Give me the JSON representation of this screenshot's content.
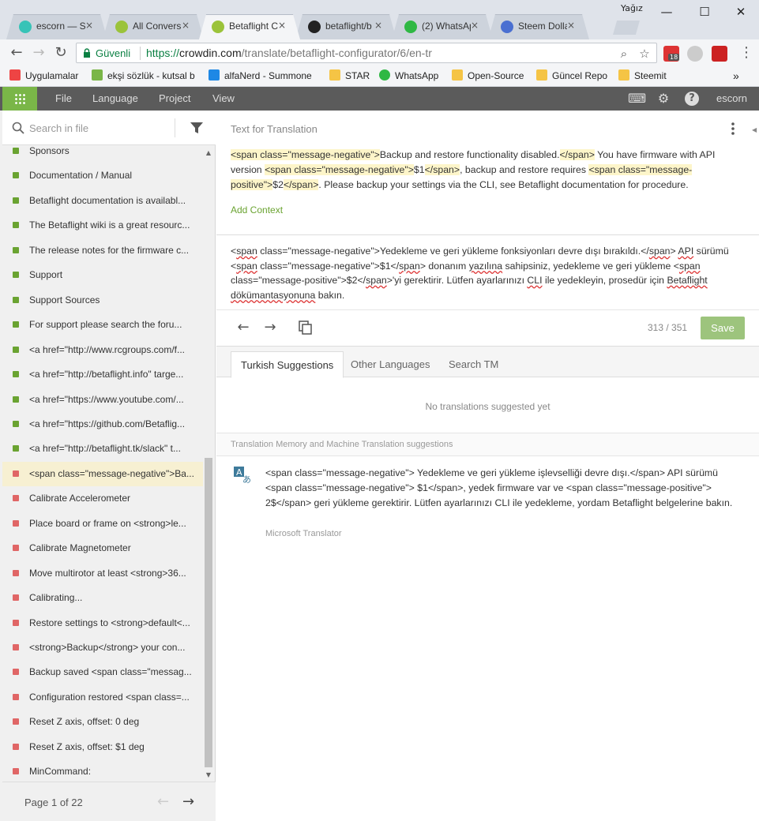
{
  "browser": {
    "user_label": "Yağız",
    "tabs": [
      {
        "title": "escorn — St",
        "icon_color": "#37c3b7",
        "active": false
      },
      {
        "title": "All Convers",
        "icon_color": "#9bc33a",
        "active": false
      },
      {
        "title": "Betaflight C",
        "icon_color": "#9bc33a",
        "active": true
      },
      {
        "title": "betaflight/b",
        "icon_color": "#222222",
        "active": false
      },
      {
        "title": "(2) WhatsAp",
        "icon_color": "#2fb844",
        "active": false
      },
      {
        "title": "Steem Dolla",
        "icon_color": "#4a6fd1",
        "active": false
      }
    ],
    "close_glyph": "×",
    "window_controls": {
      "minimize": "—",
      "maximize": "☐",
      "close": "✕"
    },
    "secure_label": "Güvenli",
    "url": {
      "scheme": "https://",
      "host": "crowdin.com",
      "path": "/translate/betaflight-configurator/6/en-tr"
    },
    "extension_badge": "18",
    "bookmarks": [
      {
        "label": "Uygulamalar",
        "icon": "apps-icon"
      },
      {
        "label": "ekşi sözlük - kutsal b",
        "icon": "eksi-icon"
      },
      {
        "label": "alfaNerd - Summone",
        "icon": "alfanerd-icon"
      },
      {
        "label": "STAR",
        "icon": "folder-icon"
      },
      {
        "label": "WhatsApp",
        "icon": "whatsapp-icon"
      },
      {
        "label": "Open-Source",
        "icon": "folder-icon"
      },
      {
        "label": "Güncel Repo",
        "icon": "folder-icon"
      },
      {
        "label": "Steemit",
        "icon": "folder-icon"
      }
    ],
    "bookmarks_more": "»"
  },
  "app": {
    "menu": [
      "File",
      "Language",
      "Project",
      "View"
    ],
    "username": "escorn",
    "accent": "#7ab648"
  },
  "sidebar": {
    "search_placeholder": "Search in file",
    "items": [
      {
        "text": "Sponsors",
        "status": "translated"
      },
      {
        "text": "Documentation / Manual",
        "status": "translated"
      },
      {
        "text": "Betaflight documentation is availabl...",
        "status": "translated"
      },
      {
        "text": "The Betaflight wiki is a great resourc...",
        "status": "translated"
      },
      {
        "text": "The release notes for the firmware c...",
        "status": "translated"
      },
      {
        "text": "Support",
        "status": "translated"
      },
      {
        "text": "Support Sources",
        "status": "translated"
      },
      {
        "text": "For support please search the foru...",
        "status": "translated"
      },
      {
        "text": "<a href=\"http://www.rcgroups.com/f...",
        "status": "translated"
      },
      {
        "text": "<a href=\"http://betaflight.info\" targe...",
        "status": "translated"
      },
      {
        "text": "<a href=\"https://www.youtube.com/...",
        "status": "translated"
      },
      {
        "text": "<a href=\"https://github.com/Betaflig...",
        "status": "translated"
      },
      {
        "text": "<a href=\"http://betaflight.tk/slack\" t...",
        "status": "translated"
      },
      {
        "text": "<span class=\"message-negative\">Ba...",
        "status": "untranslated",
        "selected": true
      },
      {
        "text": "Calibrate Accelerometer",
        "status": "untranslated"
      },
      {
        "text": "Place board or frame on <strong>le...",
        "status": "untranslated"
      },
      {
        "text": "Calibrate Magnetometer",
        "status": "untranslated"
      },
      {
        "text": "Move multirotor at least <strong>36...",
        "status": "untranslated"
      },
      {
        "text": "Calibrating...",
        "status": "untranslated"
      },
      {
        "text": "Restore settings to <strong>default<...",
        "status": "untranslated"
      },
      {
        "text": "<strong>Backup</strong> your con...",
        "status": "untranslated"
      },
      {
        "text": "Backup saved <span class=\"messag...",
        "status": "untranslated"
      },
      {
        "text": "Configuration restored <span class=...",
        "status": "untranslated"
      },
      {
        "text": "Reset Z axis, offset: 0 deg",
        "status": "untranslated"
      },
      {
        "text": "Reset Z axis, offset: $1 deg",
        "status": "untranslated"
      },
      {
        "text": "MinCommand:",
        "status": "untranslated"
      }
    ],
    "status_colors": {
      "translated": "#6aa331",
      "untranslated": "#e06666"
    },
    "pager": "Page 1 of 22"
  },
  "editor": {
    "source_label": "Text for Translation",
    "source": {
      "t1": "<span class=\"message-negative\">",
      "t2": "Backup and restore functionality disabled.",
      "t3": "</span>",
      "t4": " You have firmware with API version ",
      "t5": "<span class=\"message-negative\">",
      "t6": "$1",
      "t7": "</span>",
      "t8": ", backup and restore requires ",
      "t9": "<span class=\"message-positive\">",
      "t10": "$2",
      "t11": "</span>",
      "t12": ".  Please backup your settings via the CLI, see Betaflight documentation for procedure."
    },
    "add_context": "Add Context",
    "translation": {
      "a1": "<",
      "a2": "span",
      "a3": " class=\"message-negative\">Yedekleme ve geri yükleme fonksiyonları devre dışı bırakıldı.</",
      "a4": "span",
      "a5": "> ",
      "a6": "API",
      "a7": " sürümü <",
      "a8": "span",
      "a9": " class=\"message-negative\">$1</",
      "a10": "span",
      "a11": "> donanım ",
      "a12": "yazılına",
      "a13": " sahipsiniz, yedekleme ve geri yükleme <",
      "a14": "span",
      "a15": " class=\"message-positive\">$2</",
      "a16": "span",
      "a17": ">'yi gerektirir. Lütfen ayarlarınızı ",
      "a18": "CLI",
      "a19": " ile yedekleyin, prosedür için ",
      "a20": "Betaflight",
      "a21": " ",
      "a22": "dökümantasyonuna",
      "a23": " bakın."
    },
    "counter": "313 / 351",
    "save_label": "Save"
  },
  "suggestions": {
    "tabs": [
      "Turkish Suggestions",
      "Other Languages",
      "Search TM"
    ],
    "active_tab": 0,
    "empty_text": "No translations suggested yet",
    "tm_header": "Translation Memory and Machine Translation suggestions",
    "machine": {
      "text": "<span class=\"message-negative\"> Yedekleme ve geri yükleme işlevselliği devre dışı.</span> API sürümü <span class=\"message-negative\"> $1</span>, yedek firmware var ve <span class=\"message-positive\"> 2$</span> geri yükleme gerektirir.  Lütfen ayarlarınızı CLI ile yedekleme, yordam Betaflight belgelerine bakın.",
      "provider": "Microsoft Translator"
    }
  }
}
